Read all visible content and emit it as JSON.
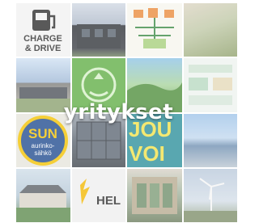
{
  "overlay_title": "yritykset",
  "tiles": {
    "charge_line1": "CHARGE",
    "charge_line2": "& DRIVE",
    "sun_line1": "SUN",
    "sun_line2": "aurinko-",
    "sun_line3": "sähkö",
    "jou_line1": "JOU",
    "jou_line2": "VOI",
    "hel_text": "HEL"
  },
  "colors": {
    "green_tile": "#5fae45",
    "sun_badge": "#1f4b8f",
    "sun_ring": "#f2c200",
    "jou_bg": "#2b8f9a",
    "jou_text": "#f1e24a"
  }
}
